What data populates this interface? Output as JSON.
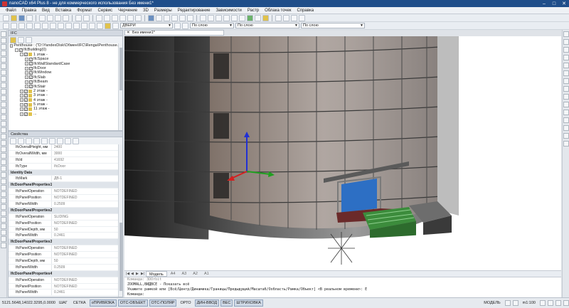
{
  "window": {
    "title": "nanoCAD x64 Plus 8 - не для коммерческого использования Без имени1*"
  },
  "menu": [
    "Файл",
    "Правка",
    "Вид",
    "Вставка",
    "Формат",
    "Сервис",
    "Черчение",
    "3D",
    "Размеры",
    "Редактирование",
    "Зависимости",
    "Растр",
    "Облака точек",
    "Справка"
  ],
  "toolbar": {
    "layer_combo": "ДВЕРИ",
    "color_combo": "По слою",
    "linetype_combo": "По слою",
    "lineweight_combo": "По слою"
  },
  "ifc_panel": {
    "title": "IFC",
    "tree": [
      {
        "level": 0,
        "label": "Penthouse : (\"D:\\YandexDisk\\Обмен\\IFC\\Renga\\Penthouse.ifc\")",
        "expanded": true
      },
      {
        "level": 1,
        "label": "IfcBuilding(0)",
        "expanded": true
      },
      {
        "level": 2,
        "label": "1 этаж -",
        "expanded": true
      },
      {
        "level": 3,
        "label": "IfcSpace"
      },
      {
        "level": 3,
        "label": "IfcWallStandardCase"
      },
      {
        "level": 3,
        "label": "IfcDoor"
      },
      {
        "level": 3,
        "label": "IfcWindow"
      },
      {
        "level": 3,
        "label": "IfcSlab"
      },
      {
        "level": 3,
        "label": "IfcBeam"
      },
      {
        "level": 3,
        "label": "IfcStair"
      },
      {
        "level": 2,
        "label": "2 этаж -"
      },
      {
        "level": 2,
        "label": "3 этаж -"
      },
      {
        "level": 2,
        "label": "4 этаж -"
      },
      {
        "level": 2,
        "label": "5 этаж -"
      },
      {
        "level": 2,
        "label": "11 этаж -"
      },
      {
        "level": 2,
        "label": "..."
      }
    ]
  },
  "props_panel": {
    "title": "Свойства",
    "rows": [
      {
        "type": "row",
        "k": "IfcOverallHeight, мм",
        "v": "2400"
      },
      {
        "type": "row",
        "k": "IfcOverallWidth, мм",
        "v": "3000"
      },
      {
        "type": "row",
        "k": "IfcId",
        "v": "41692"
      },
      {
        "type": "row",
        "k": "IfcType",
        "v": "IfcDoor"
      },
      {
        "type": "section",
        "k": "Identity Data"
      },
      {
        "type": "row",
        "k": "IfcMark",
        "v": "ДВ-1"
      },
      {
        "type": "section",
        "k": "IfcDoorPanelProperties1"
      },
      {
        "type": "row",
        "k": "IfcPanelOperation",
        "v": "NOTDEFINED"
      },
      {
        "type": "row",
        "k": "IfcPanelPosition",
        "v": "NOTDEFINED"
      },
      {
        "type": "row",
        "k": "IfcPanelWidth",
        "v": "0.2509"
      },
      {
        "type": "section",
        "k": "IfcDoorPanelProperties2"
      },
      {
        "type": "row",
        "k": "IfcPanelOperation",
        "v": "SLIDING"
      },
      {
        "type": "row",
        "k": "IfcPanelPosition",
        "v": "NOTDEFINED"
      },
      {
        "type": "row",
        "k": "IfcPanelDepth, мм",
        "v": "50"
      },
      {
        "type": "row",
        "k": "IfcPanelWidth",
        "v": "0.2461"
      },
      {
        "type": "section",
        "k": "IfcDoorPanelProperties3"
      },
      {
        "type": "row",
        "k": "IfcPanelOperation",
        "v": "NOTDEFINED"
      },
      {
        "type": "row",
        "k": "IfcPanelPosition",
        "v": "NOTDEFINED"
      },
      {
        "type": "row",
        "k": "IfcPanelDepth, мм",
        "v": "50"
      },
      {
        "type": "row",
        "k": "IfcPanelWidth",
        "v": "0.2509"
      },
      {
        "type": "section",
        "k": "IfcDoorPanelProperties4"
      },
      {
        "type": "row",
        "k": "IfcPanelOperation",
        "v": "NOTDEFINED"
      },
      {
        "type": "row",
        "k": "IfcPanelPosition",
        "v": "NOTDEFINED"
      },
      {
        "type": "row",
        "k": "IfcPanelWidth",
        "v": "0.2461"
      }
    ]
  },
  "document_tab": {
    "label": "Без имени1*"
  },
  "layout_tabs": [
    "Модель",
    "А4",
    "А3",
    "А2",
    "А1"
  ],
  "command_line": {
    "lines": [
      "Команда: 3DOrbit",
      "ZOOMALL,ВИДВСЕ - Показать всё",
      "Укажите рамкой или [Всё/Центр/Динамика/Границы/Предыдущий/Масштаб/Ообласть/Рамка/Объект] <В реальном времени>: E",
      "Команда:"
    ]
  },
  "statusbar": {
    "coords": "5121.5648,14022.3295,0.0000",
    "toggles": [
      {
        "label": "ШАГ",
        "on": false
      },
      {
        "label": "СЕТКА",
        "on": false
      },
      {
        "label": "оПРИВЯЗКА",
        "on": true
      },
      {
        "label": "ОТС-ОБЪЕКТ",
        "on": true
      },
      {
        "label": "ОТС-ПОЛЯР",
        "on": true
      },
      {
        "label": "ОРТО",
        "on": false
      },
      {
        "label": "ДИН-ВВОД",
        "on": true
      },
      {
        "label": "ВЕС",
        "on": true
      },
      {
        "label": "ШТРИХОВКА",
        "on": true
      }
    ],
    "model": "МОДЕЛЬ",
    "scale": "m1:100"
  },
  "colors": {
    "title_bar": "#1f4e8a",
    "glass_door": "#2d6fc4",
    "stairs": "#4aa04a",
    "axis_x": "#d42020",
    "axis_y": "#20a020",
    "axis_z": "#2030d4"
  }
}
